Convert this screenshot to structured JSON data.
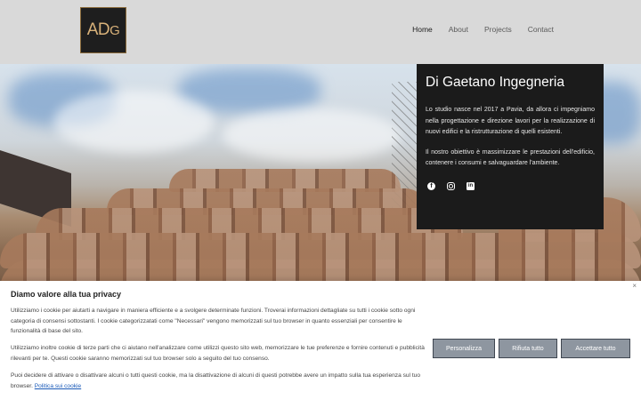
{
  "header": {
    "logo_text_a": "AD",
    "logo_text_b": "G",
    "nav": [
      {
        "label": "Home",
        "active": true
      },
      {
        "label": "About"
      },
      {
        "label": "Projects"
      },
      {
        "label": "Contact"
      }
    ]
  },
  "hero": {
    "title": "Di Gaetano Ingegneria",
    "paragraph1": "Lo studio nasce nel 2017 a Pavia, da allora ci impegniamo nella progettazione e direzione lavori per la realizzazione di nuovi edifici e la ristrutturazione di quelli esistenti.",
    "paragraph2": "Il nostro obiettivo è massimizzare le prestazioni dell'edificio, contenere i consumi e salvaguardare l'ambiente.",
    "social_icons": [
      "facebook-icon",
      "instagram-icon",
      "linkedin-icon"
    ]
  },
  "cookie_banner": {
    "title": "Diamo valore alla tua privacy",
    "paragraph1": "Utilizziamo i cookie per aiutarti a navigare in maniera efficiente e a svolgere determinate funzioni. Troverai informazioni dettagliate su tutti i cookie sotto ogni categoria di consensi sottostanti. I cookie categorizzatati come \"Necessari\" vengono memorizzati sul tuo browser in quanto essenziali per consentire le funzionalità di base del sito.",
    "paragraph2": "Utilizziamo inoltre cookie di terze parti che ci aiutano nell'analizzare come utilizzi questo sito web, memorizzare le tue preferenze e fornire contenuti e pubblicità rilevanti per te. Questi cookie saranno memorizzati sul tuo browser solo a seguito del tuo consenso.",
    "paragraph3": "Puoi decidere di attivare o disattivare alcuni o tutti questi cookie, ma la disattivazione di alcuni di questi potrebbe avere un impatto sulla tua esperienza sul tuo browser.",
    "policy_link": "Politica sui cookie",
    "close_symbol": "×",
    "buttons": {
      "personalizza": "Personalizza",
      "rifiuta": "Rifiuta tutto",
      "accetta": "Accettare tutto"
    },
    "button_color": "#8e96a0"
  }
}
